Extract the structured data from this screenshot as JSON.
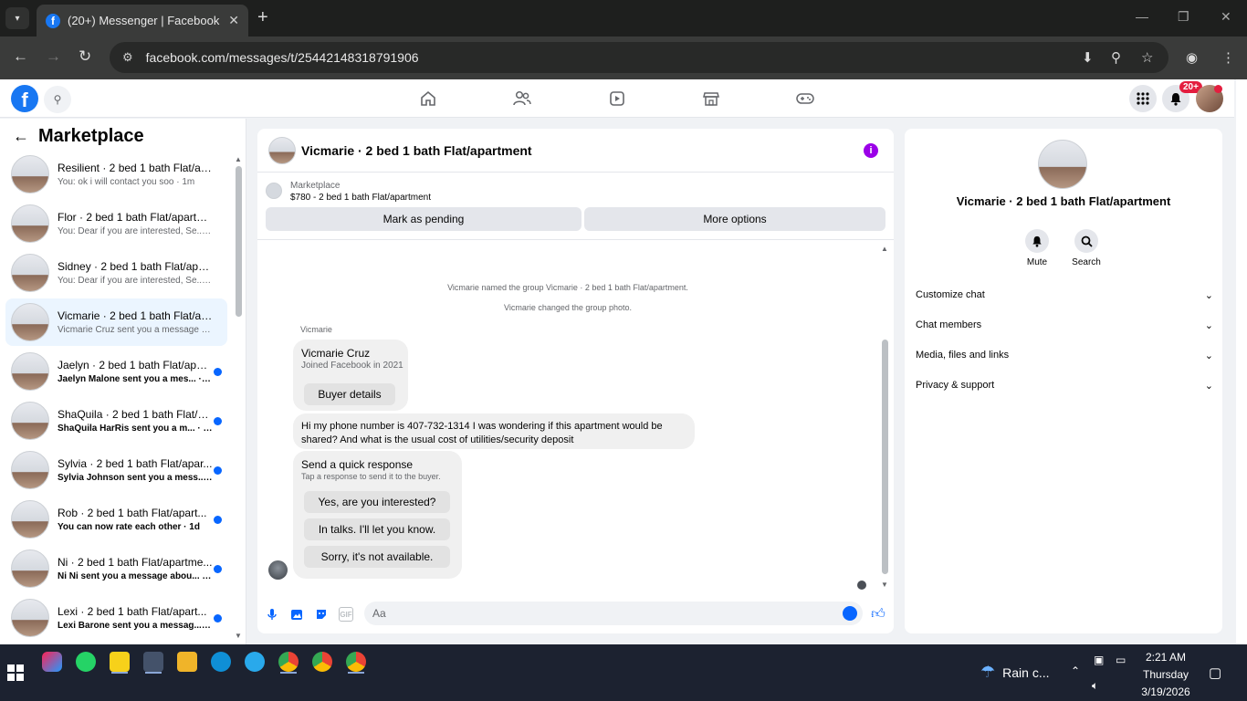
{
  "browser": {
    "tab_title": "(20+) Messenger | Facebook",
    "tab_favicon": "f",
    "url": "facebook.com/messages/t/25442148318791906"
  },
  "fb": {
    "logo": "f",
    "notif_badge": "20+",
    "nav_icons": [
      "home-icon",
      "friends-icon",
      "watch-icon",
      "marketplace-icon",
      "gaming-icon"
    ]
  },
  "sidebar": {
    "title": "Marketplace",
    "conversations": [
      {
        "name": "Resilient · 2 bed 1 bath Flat/apa...",
        "preview": "You: ok i will contact you soo · 1m",
        "unread": false
      },
      {
        "name": "Flor · 2 bed 1 bath Flat/apartment",
        "preview": "You: Dear if you are interested, Se... · 2m",
        "unread": false
      },
      {
        "name": "Sidney · 2 bed 1 bath Flat/apartm...",
        "preview": "You: Dear if you are interested, Se... · 2m",
        "unread": false
      },
      {
        "name": "Vicmarie · 2 bed 1 bath Flat/apa...",
        "preview": "Vicmarie Cruz sent you a message ... · 5h",
        "unread": false,
        "active": true
      },
      {
        "name": "Jaelyn · 2 bed 1 bath Flat/apar...",
        "preview": "Jaelyn Malone sent you a mes... · 20h",
        "unread": true
      },
      {
        "name": "ShaQuila · 2 bed 1 bath Flat/a...",
        "preview": "ShaQuila HarRis sent you a m... · 23h",
        "unread": true
      },
      {
        "name": "Sylvia · 2 bed 1 bath Flat/apar...",
        "preview": "Sylvia Johnson sent you a mess... · 1d",
        "unread": true
      },
      {
        "name": "Rob · 2 bed 1 bath Flat/apart...",
        "preview": "You can now rate each other · 1d",
        "unread": true
      },
      {
        "name": "Ni · 2 bed 1 bath Flat/apartme...",
        "preview": "Ni Ni sent you a message abou... · 1d",
        "unread": true
      },
      {
        "name": "Lexi · 2 bed 1 bath Flat/apart...",
        "preview": "Lexi Barone sent you a messag... · 1d",
        "unread": true
      }
    ]
  },
  "chat": {
    "title": "Vicmarie · 2 bed 1 bath Flat/apartment",
    "marketplace_label": "Marketplace",
    "listing": "$780 - 2 bed 1 bath Flat/apartment",
    "mark_pending": "Mark as pending",
    "more_options": "More options",
    "system_1": "Vicmarie named the group Vicmarie · 2 bed 1 bath Flat/apartment.",
    "system_2": "Vicmarie changed the group photo.",
    "sender": "Vicmarie",
    "buyer_name": "Vicmarie Cruz",
    "buyer_joined": "Joined Facebook in 2021",
    "buyer_details": "Buyer details",
    "message": "Hi my phone number is 407-732-1314 I was wondering if this apartment would be shared? And what is the usual cost of utilities/security deposit",
    "quick_title": "Send a quick response",
    "quick_sub": "Tap a response to send it to the buyer.",
    "quick_responses": [
      "Yes, are you interested?",
      "In talks. I'll let you know.",
      "Sorry, it's not available."
    ],
    "input_placeholder": "Aa",
    "gif_label": "GIF"
  },
  "right_panel": {
    "name": "Vicmarie · 2 bed 1 bath Flat/apartment",
    "mute": "Mute",
    "search": "Search",
    "sections": [
      "Customize chat",
      "Chat members",
      "Media, files and links",
      "Privacy & support"
    ]
  },
  "taskbar": {
    "weather": "Rain c...",
    "time": "2:21 AM",
    "day": "Thursday",
    "date": "3/19/2026"
  }
}
